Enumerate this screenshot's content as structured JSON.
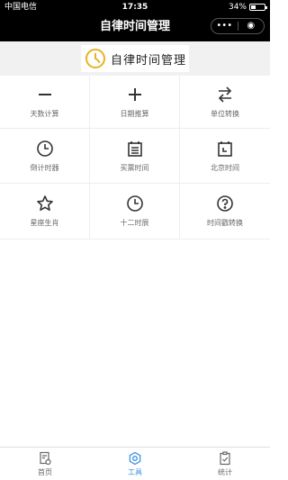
{
  "status_bar": {
    "carrier": "中国电信",
    "time": "17:35",
    "battery": "34%",
    "battery_level": 0.34
  },
  "nav": {
    "title": "自律时间管理",
    "capsule_more": "•••",
    "capsule_close": "◉"
  },
  "banner": {
    "logo_text": "自律时间管理",
    "accent_color": "#e6b325"
  },
  "tools": [
    {
      "label": "天数计算",
      "icon": "minus-icon"
    },
    {
      "label": "日期推算",
      "icon": "plus-icon"
    },
    {
      "label": "单位转换",
      "icon": "swap-arrows-icon"
    },
    {
      "label": "倒计时器",
      "icon": "clock-icon"
    },
    {
      "label": "买票时间",
      "icon": "calendar-list-icon"
    },
    {
      "label": "北京时间",
      "icon": "calendar-clock-icon"
    },
    {
      "label": "星座生肖",
      "icon": "star-icon"
    },
    {
      "label": "十二时辰",
      "icon": "clock-icon"
    },
    {
      "label": "时间戳转换",
      "icon": "question-circle-icon"
    }
  ],
  "tabbar": {
    "items": [
      {
        "label": "首页",
        "icon": "home-doc-icon",
        "active": false
      },
      {
        "label": "工具",
        "icon": "gear-icon",
        "active": true
      },
      {
        "label": "统计",
        "icon": "clipboard-check-icon",
        "active": false
      }
    ],
    "active_color": "#3b8fe0"
  }
}
